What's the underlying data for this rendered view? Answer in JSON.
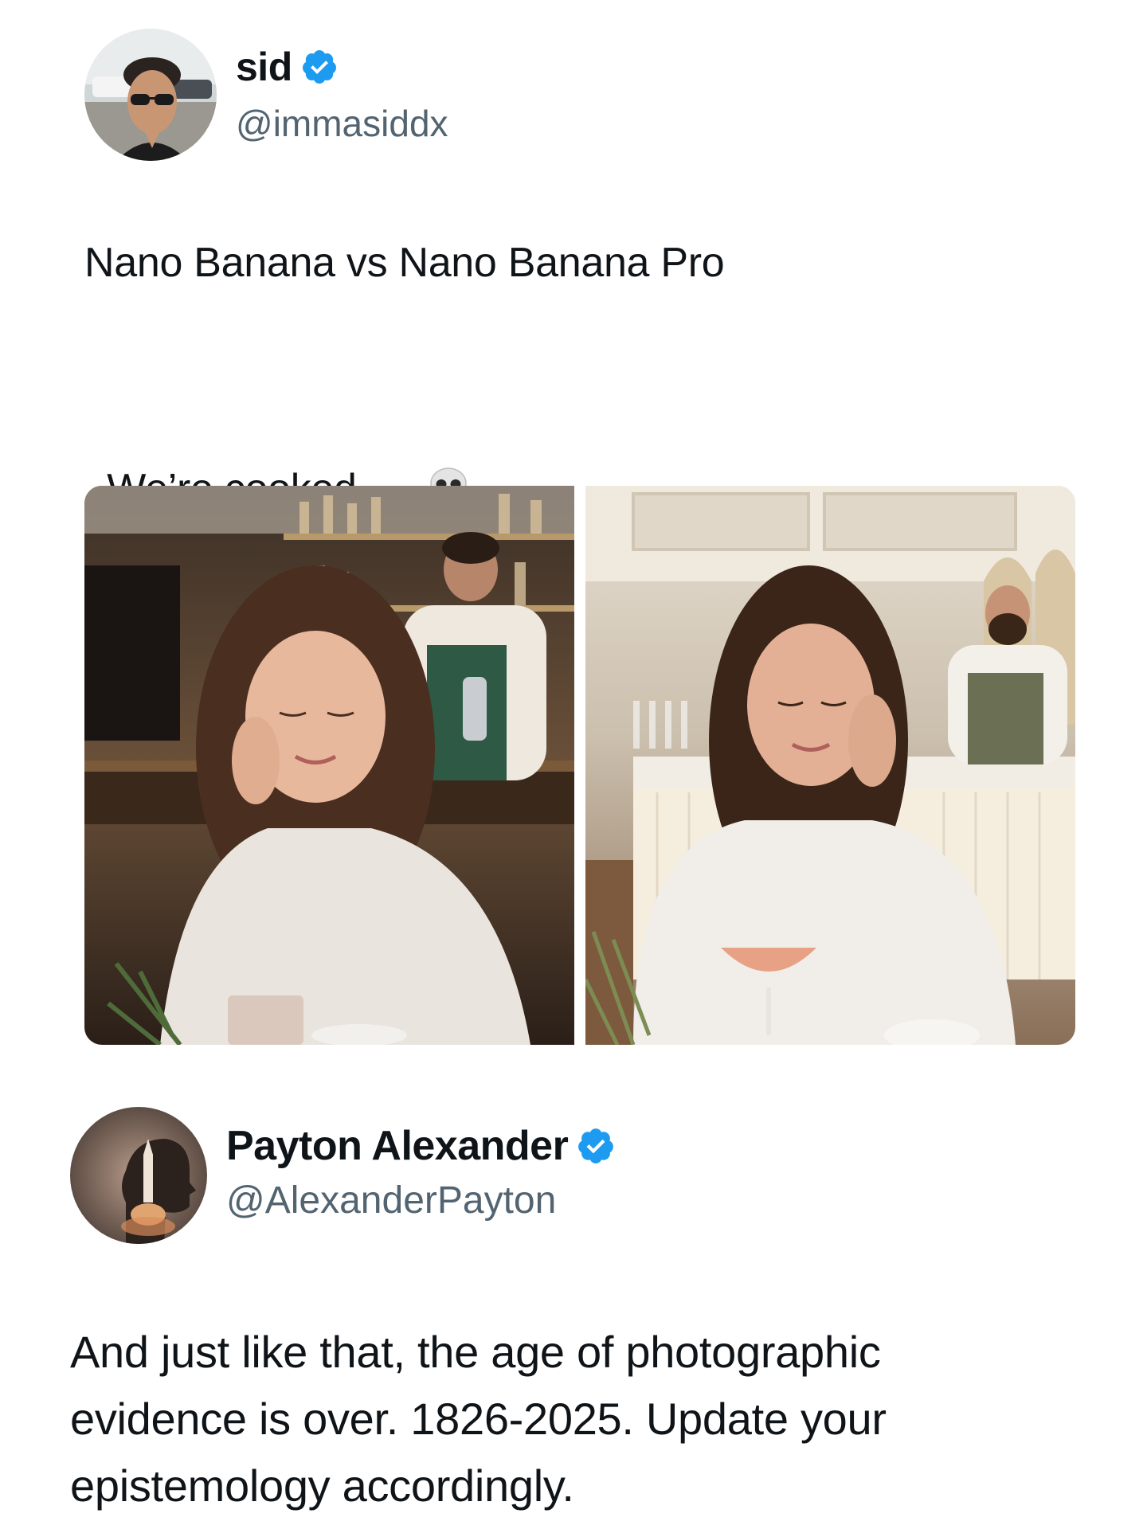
{
  "tweet": {
    "author": {
      "name": "sid",
      "handle": "@immasiddx",
      "verified": true,
      "avatar_icon": "avatar-photo-man-sunglasses"
    },
    "text_line_1": "Nano Banana vs Nano Banana Pro",
    "text_line_2": "We’re cooked.",
    "emoji_icon": "skull-icon",
    "media": [
      {
        "label": "nano-banana-photo",
        "icon": "photo-woman-cafe-bartender"
      },
      {
        "label": "nano-banana-pro-photo",
        "icon": "photo-woman-restaurant-bartender"
      }
    ]
  },
  "reply": {
    "author": {
      "name": "Payton Alexander",
      "handle": "@AlexanderPayton",
      "verified": true,
      "avatar_icon": "avatar-silhouette-rocket"
    },
    "text": "And just like that, the age of photographic\nevidence is over. 1826-2025. Update your\nepistemology accordingly."
  },
  "colors": {
    "verified_badge": "#1d9bf0",
    "text_primary": "#0f1419",
    "text_secondary": "#536471"
  }
}
